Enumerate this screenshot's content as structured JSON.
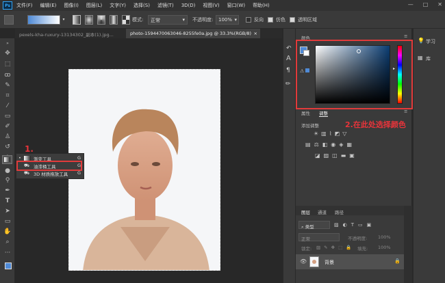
{
  "app": {
    "logo": "Ps"
  },
  "menu": [
    "文件(F)",
    "编辑(E)",
    "图像(I)",
    "图层(L)",
    "文字(Y)",
    "选择(S)",
    "滤镜(T)",
    "3D(D)",
    "视图(V)",
    "窗口(W)",
    "帮助(H)"
  ],
  "window_controls": {
    "minimize": "—",
    "maximize": "□",
    "close": "✕"
  },
  "options": {
    "mode_label": "模式:",
    "mode_value": "正常",
    "opacity_label": "不透明度:",
    "opacity_value": "100%",
    "reverse_label": "反向",
    "dither_label": "仿色",
    "transparency_label": "透明区域"
  },
  "tabs": [
    {
      "label": "pexels-kha-ruxury-13134302_副本(1).jpg..."
    },
    {
      "label": "photo-1594470063046-8255fe0a.jpg @ 33.3%(RGB/8)"
    }
  ],
  "flyout": {
    "items": [
      {
        "label": "渐变工具",
        "shortcut": "G"
      },
      {
        "label": "油漆桶工具",
        "shortcut": "G"
      },
      {
        "label": "3D 材质拖放工具",
        "shortcut": "G"
      }
    ]
  },
  "panels": {
    "color_tab": "颜色",
    "properties_tab": "属性",
    "adjustments_tab": "调整",
    "add_adjustment": "添加调整",
    "layers_tab": "图层",
    "channels_tab": "通道",
    "paths_tab": "路径",
    "kind_filter": "类型",
    "blend_mode": "正常",
    "opacity_label": "不透明度:",
    "opacity_value": "100%",
    "lock_label": "锁定:",
    "fill_label": "填充:",
    "fill_value": "100%",
    "layer_name": "背景"
  },
  "side": {
    "learn": "学习",
    "library": "库"
  },
  "annotations": {
    "step1": "1.",
    "step2": "2.在此处选择颜色"
  },
  "colors": {
    "accent_red": "#e23b3b",
    "foreground": "#4f8ad6",
    "hue_selected": "#0b3d73"
  }
}
